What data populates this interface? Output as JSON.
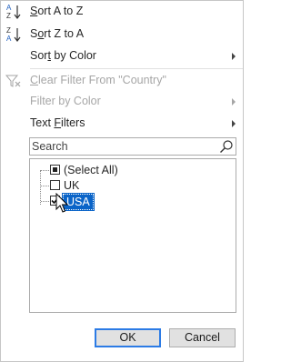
{
  "menu": {
    "sort_az": {
      "prefix": "",
      "underline": "S",
      "rest": "ort A to Z"
    },
    "sort_za": {
      "prefix": "S",
      "underline": "o",
      "rest": "rt Z to A"
    },
    "sort_by_color": {
      "prefix": "Sor",
      "underline": "t",
      "rest": " by Color"
    },
    "clear_filter": {
      "prefix": "",
      "underline": "C",
      "rest": "lear Filter From \"Country\""
    },
    "filter_by_color": {
      "prefix": "",
      "underline": "",
      "rest": "Filter by Color"
    },
    "text_filters": {
      "prefix": "",
      "underline": "F",
      "rest_before": "Text ",
      "rest": "ilters"
    }
  },
  "search": {
    "placeholder": "Search"
  },
  "list": {
    "items": [
      {
        "label": "(Select All)",
        "state": "indeterminate"
      },
      {
        "label": "UK",
        "state": "unchecked"
      },
      {
        "label": "USA",
        "state": "checked"
      }
    ]
  },
  "buttons": {
    "ok": "OK",
    "cancel": "Cancel"
  },
  "colors": {
    "accent": "#0a64c8",
    "sort_blue": "#1f5fbf",
    "default_border": "#2c7be5"
  },
  "icons": [
    "sort-az-icon",
    "sort-za-icon",
    "clear-filter-icon",
    "search-icon",
    "mouse-cursor-icon"
  ]
}
